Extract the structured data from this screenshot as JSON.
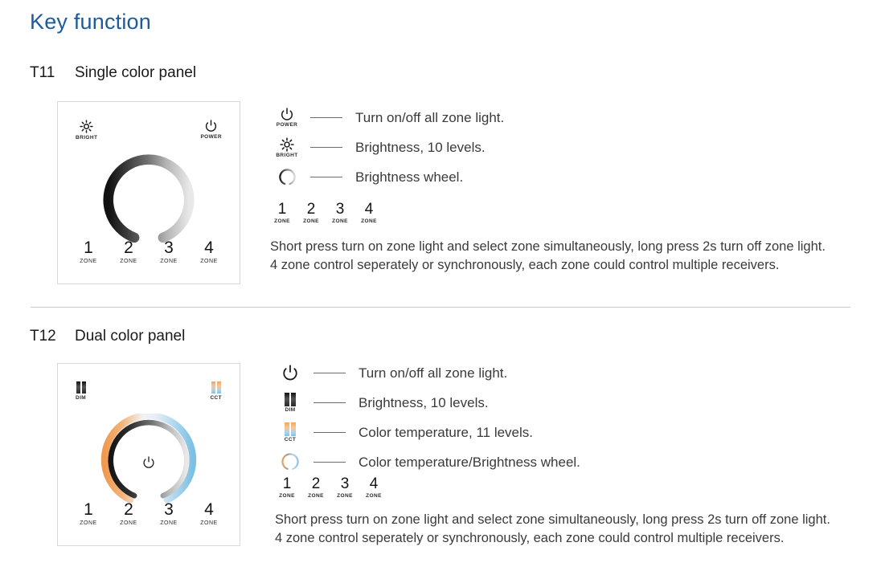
{
  "page": {
    "title": "Key function"
  },
  "sections": [
    {
      "code": "T11",
      "name": "Single color panel",
      "panel": {
        "top_left": {
          "icon": "sun-bright-icon",
          "label": "BRIGHT"
        },
        "top_right": {
          "icon": "power-icon",
          "label": "POWER"
        },
        "wheel": "brightness-wheel",
        "zones": [
          {
            "num": "1",
            "sub": "ZONE"
          },
          {
            "num": "2",
            "sub": "ZONE"
          },
          {
            "num": "3",
            "sub": "ZONE"
          },
          {
            "num": "4",
            "sub": "ZONE"
          }
        ]
      },
      "legend": [
        {
          "icon": "power-icon",
          "sub": "POWER",
          "text": "Turn on/off all zone light."
        },
        {
          "icon": "sun-bright-icon",
          "sub": "BRIGHT",
          "text": "Brightness, 10 levels."
        },
        {
          "icon": "wheel-arc-icon",
          "sub": "",
          "text": "Brightness wheel."
        }
      ],
      "legend_zones": [
        {
          "num": "1",
          "sub": "ZONE"
        },
        {
          "num": "2",
          "sub": "ZONE"
        },
        {
          "num": "3",
          "sub": "ZONE"
        },
        {
          "num": "4",
          "sub": "ZONE"
        }
      ],
      "description": "Short press turn on zone light and select zone simultaneously, long press 2s turn off zone light.\n4 zone control seperately or synchronously, each zone could control multiple receivers."
    },
    {
      "code": "T12",
      "name": "Dual color panel",
      "panel": {
        "top_left": {
          "icon": "dim-bars-icon",
          "label": "DIM"
        },
        "top_right": {
          "icon": "cct-bars-icon",
          "label": "CCT"
        },
        "wheel": "cct-brightness-wheel",
        "center_icon": "power-icon",
        "zones": [
          {
            "num": "1",
            "sub": "ZONE"
          },
          {
            "num": "2",
            "sub": "ZONE"
          },
          {
            "num": "3",
            "sub": "ZONE"
          },
          {
            "num": "4",
            "sub": "ZONE"
          }
        ]
      },
      "legend": [
        {
          "icon": "power-icon",
          "sub": "",
          "text": "Turn on/off all zone light."
        },
        {
          "icon": "dim-bars-icon",
          "sub": "DIM",
          "text": "Brightness, 10 levels."
        },
        {
          "icon": "cct-bars-icon",
          "sub": "CCT",
          "text": "Color temperature, 11 levels."
        },
        {
          "icon": "wheel-arc-color-icon",
          "sub": "",
          "text": "Color temperature/Brightness wheel."
        }
      ],
      "legend_zones": [
        {
          "num": "1",
          "sub": "ZONE"
        },
        {
          "num": "2",
          "sub": "ZONE"
        },
        {
          "num": "3",
          "sub": "ZONE"
        },
        {
          "num": "4",
          "sub": "ZONE"
        }
      ],
      "description": "Short press turn on zone light and select zone simultaneously, long press 2s turn off zone light.\n4 zone control seperately or synchronously, each zone could control multiple receivers."
    }
  ],
  "colors": {
    "title_blue": "#1b5c9e",
    "body_text": "#3a3a3a",
    "panel_border": "#d8d8d8",
    "divider": "#c9c9c9",
    "cct_warm": "#f0a562",
    "cct_cool": "#86bde0"
  }
}
